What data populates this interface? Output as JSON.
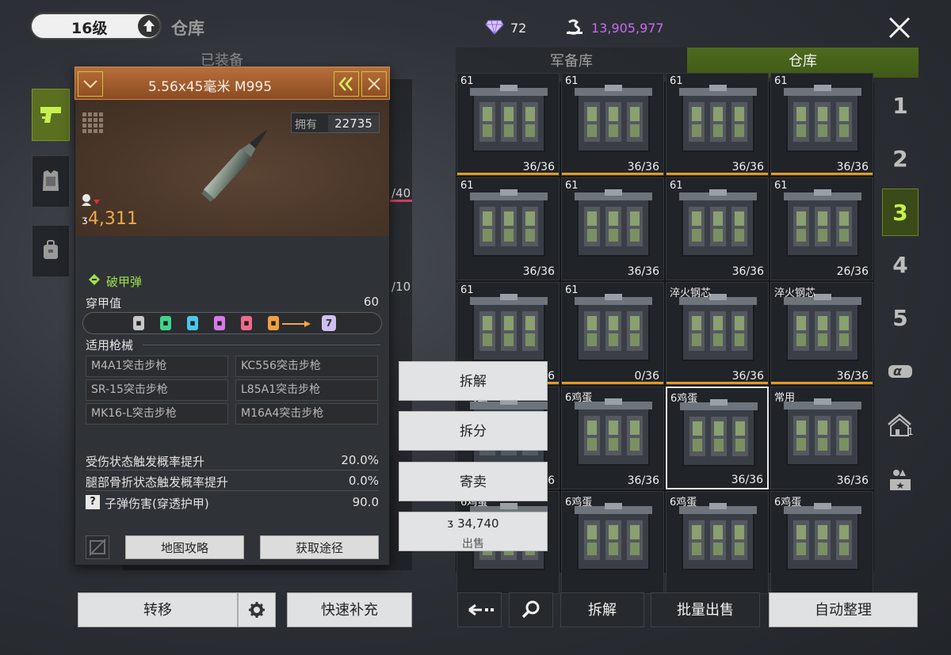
{
  "topbar": {
    "level": "16级",
    "title": "仓库",
    "gems": "72",
    "coins": "13,905,977"
  },
  "tabs": {
    "equipped": "已装备",
    "arsenal": "军备库",
    "warehouse": "仓库"
  },
  "equipped_bg": {
    "frac1": "/40",
    "frac2": "/10"
  },
  "item": {
    "name": "5.56x45毫米 M995",
    "own_label": "拥有",
    "own_count": "22735",
    "price": "4,311",
    "ammo_type": "破甲弹",
    "penetration_label": "穿甲值",
    "penetration_value": "60",
    "penetration_tier": "7",
    "tier_colors": [
      "#c8c8c8",
      "#3ed68a",
      "#4ac8e8",
      "#d77ae8",
      "#f06a8a",
      "#f0a040"
    ],
    "guns_title": "适用枪械",
    "guns": [
      "M4A1突击步枪",
      "KC556突击步枪",
      "SR-15突击步枪",
      "L85A1突击步枪",
      "MK16-L突击步枪",
      "M16A4突击步枪"
    ],
    "stats": [
      {
        "label": "受伤状态触发概率提升",
        "value": "20.0%"
      },
      {
        "label": "腿部骨折状态触发概率提升",
        "value": "0.0%"
      },
      {
        "label": "子弹伤害(穿透护甲)",
        "value": "90.0"
      }
    ],
    "help_glyph": "?",
    "map_guide": "地图攻略",
    "obtain": "获取途径"
  },
  "context_menu": {
    "dismantle": "拆解",
    "split": "拆分",
    "consign": "寄卖",
    "sell_price": "34,740",
    "sell": "出售"
  },
  "grid": {
    "cells": [
      {
        "tag": "61",
        "count": "36/36",
        "bar": true
      },
      {
        "tag": "61",
        "count": "36/36",
        "bar": true
      },
      {
        "tag": "61",
        "count": "36/36",
        "bar": true
      },
      {
        "tag": "61",
        "count": "36/36",
        "bar": true
      },
      {
        "tag": "61",
        "count": "36/36",
        "bar": false
      },
      {
        "tag": "61",
        "count": "36/36",
        "bar": false
      },
      {
        "tag": "61",
        "count": "36/36",
        "bar": false
      },
      {
        "tag": "61",
        "count": "26/36",
        "bar": false
      },
      {
        "tag": "61",
        "count": "36/36",
        "bar": true
      },
      {
        "tag": "61",
        "count": "0/36",
        "bar": true
      },
      {
        "tag": "淬火钢芯",
        "count": "36/36",
        "bar": true
      },
      {
        "tag": "淬火钢芯",
        "count": "36/36",
        "bar": true
      },
      {
        "tag": "6鸡蛋",
        "count": "36/36",
        "bar": false
      },
      {
        "tag": "6鸡蛋",
        "count": "36/36",
        "bar": false
      },
      {
        "tag": "6鸡蛋",
        "count": "36/36",
        "bar": false,
        "selected": true
      },
      {
        "tag": "常用",
        "count": "36/36",
        "bar": false
      },
      {
        "tag": "6鸡蛋",
        "count": "",
        "bar": false
      },
      {
        "tag": "6鸡蛋",
        "count": "",
        "bar": false
      },
      {
        "tag": "6鸡蛋",
        "count": "",
        "bar": false
      },
      {
        "tag": "6鸡蛋",
        "count": "",
        "bar": false
      }
    ]
  },
  "pages": [
    "1",
    "2",
    "3",
    "4",
    "5"
  ],
  "page_icons": {
    "alpha": "α",
    "home_num": "1"
  },
  "bottom": {
    "transfer": "转移",
    "quick_refill": "快速补充",
    "dismantle": "拆解",
    "bulk_sell": "批量出售",
    "auto_sort": "自动整理"
  }
}
